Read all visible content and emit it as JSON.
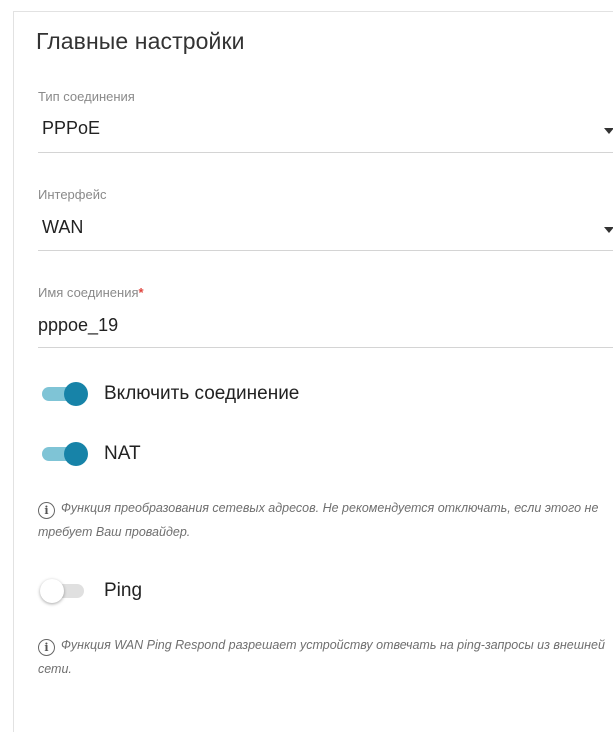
{
  "section": {
    "title": "Главные настройки"
  },
  "connection_type": {
    "label": "Тип соединения",
    "value": "PPPoE"
  },
  "interface": {
    "label": "Интерфейс",
    "value": "WAN"
  },
  "connection_name": {
    "label": "Имя соединения",
    "required_mark": "*",
    "value": "pppoe_19"
  },
  "toggles": {
    "enable_connection": {
      "label": "Включить соединение",
      "state": "on"
    },
    "nat": {
      "label": "NAT",
      "state": "on"
    },
    "ping": {
      "label": "Ping",
      "state": "off"
    }
  },
  "hints": {
    "nat": "Функция преобразования сетевых адресов. Не рекомендуется отключать, если этого не требует Ваш провайдер.",
    "ping": "Функция WAN Ping Respond разрешает устройству отвечать на ping-запросы из внешней сети."
  },
  "icons": {
    "info": "i"
  },
  "colors": {
    "toggle_on_thumb": "#1783a8",
    "toggle_on_track": "#7fc4d6",
    "required": "#e0463f"
  }
}
